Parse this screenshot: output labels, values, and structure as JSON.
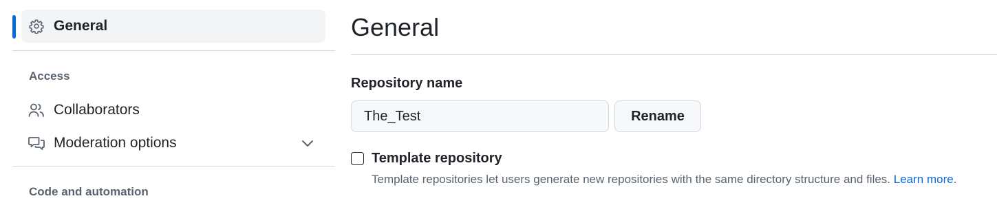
{
  "sidebar": {
    "items": [
      {
        "label": "General",
        "icon": "gear-icon",
        "active": true
      },
      {
        "label": "Collaborators",
        "icon": "people-icon"
      },
      {
        "label": "Moderation options",
        "icon": "comment-discussion-icon",
        "expandable": true
      }
    ],
    "sections": {
      "access": "Access",
      "code_automation": "Code and automation"
    }
  },
  "main": {
    "title": "General",
    "repo_name": {
      "label": "Repository name",
      "value": "The_Test",
      "rename_label": "Rename"
    },
    "template": {
      "label": "Template repository",
      "checked": false,
      "description": "Template repositories let users generate new repositories with the same directory structure and files.",
      "learn_more": "Learn more",
      "trailing_period": "."
    }
  },
  "colors": {
    "accent": "#0969da",
    "active_bg": "#f3f4f6",
    "border": "#d1d9e0",
    "muted_text": "#59636e"
  }
}
